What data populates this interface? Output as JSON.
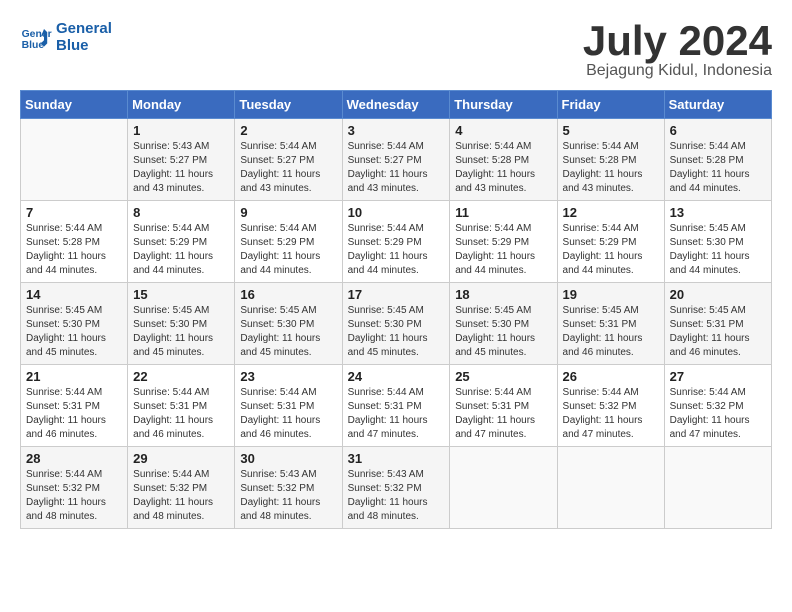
{
  "logo": {
    "line1": "General",
    "line2": "Blue"
  },
  "title": {
    "month": "July 2024",
    "location": "Bejagung Kidul, Indonesia"
  },
  "headers": [
    "Sunday",
    "Monday",
    "Tuesday",
    "Wednesday",
    "Thursday",
    "Friday",
    "Saturday"
  ],
  "weeks": [
    [
      {
        "day": "",
        "info": ""
      },
      {
        "day": "1",
        "info": "Sunrise: 5:43 AM\nSunset: 5:27 PM\nDaylight: 11 hours\nand 43 minutes."
      },
      {
        "day": "2",
        "info": "Sunrise: 5:44 AM\nSunset: 5:27 PM\nDaylight: 11 hours\nand 43 minutes."
      },
      {
        "day": "3",
        "info": "Sunrise: 5:44 AM\nSunset: 5:27 PM\nDaylight: 11 hours\nand 43 minutes."
      },
      {
        "day": "4",
        "info": "Sunrise: 5:44 AM\nSunset: 5:28 PM\nDaylight: 11 hours\nand 43 minutes."
      },
      {
        "day": "5",
        "info": "Sunrise: 5:44 AM\nSunset: 5:28 PM\nDaylight: 11 hours\nand 43 minutes."
      },
      {
        "day": "6",
        "info": "Sunrise: 5:44 AM\nSunset: 5:28 PM\nDaylight: 11 hours\nand 44 minutes."
      }
    ],
    [
      {
        "day": "7",
        "info": "Sunrise: 5:44 AM\nSunset: 5:28 PM\nDaylight: 11 hours\nand 44 minutes."
      },
      {
        "day": "8",
        "info": "Sunrise: 5:44 AM\nSunset: 5:29 PM\nDaylight: 11 hours\nand 44 minutes."
      },
      {
        "day": "9",
        "info": "Sunrise: 5:44 AM\nSunset: 5:29 PM\nDaylight: 11 hours\nand 44 minutes."
      },
      {
        "day": "10",
        "info": "Sunrise: 5:44 AM\nSunset: 5:29 PM\nDaylight: 11 hours\nand 44 minutes."
      },
      {
        "day": "11",
        "info": "Sunrise: 5:44 AM\nSunset: 5:29 PM\nDaylight: 11 hours\nand 44 minutes."
      },
      {
        "day": "12",
        "info": "Sunrise: 5:44 AM\nSunset: 5:29 PM\nDaylight: 11 hours\nand 44 minutes."
      },
      {
        "day": "13",
        "info": "Sunrise: 5:45 AM\nSunset: 5:30 PM\nDaylight: 11 hours\nand 44 minutes."
      }
    ],
    [
      {
        "day": "14",
        "info": "Sunrise: 5:45 AM\nSunset: 5:30 PM\nDaylight: 11 hours\nand 45 minutes."
      },
      {
        "day": "15",
        "info": "Sunrise: 5:45 AM\nSunset: 5:30 PM\nDaylight: 11 hours\nand 45 minutes."
      },
      {
        "day": "16",
        "info": "Sunrise: 5:45 AM\nSunset: 5:30 PM\nDaylight: 11 hours\nand 45 minutes."
      },
      {
        "day": "17",
        "info": "Sunrise: 5:45 AM\nSunset: 5:30 PM\nDaylight: 11 hours\nand 45 minutes."
      },
      {
        "day": "18",
        "info": "Sunrise: 5:45 AM\nSunset: 5:30 PM\nDaylight: 11 hours\nand 45 minutes."
      },
      {
        "day": "19",
        "info": "Sunrise: 5:45 AM\nSunset: 5:31 PM\nDaylight: 11 hours\nand 46 minutes."
      },
      {
        "day": "20",
        "info": "Sunrise: 5:45 AM\nSunset: 5:31 PM\nDaylight: 11 hours\nand 46 minutes."
      }
    ],
    [
      {
        "day": "21",
        "info": "Sunrise: 5:44 AM\nSunset: 5:31 PM\nDaylight: 11 hours\nand 46 minutes."
      },
      {
        "day": "22",
        "info": "Sunrise: 5:44 AM\nSunset: 5:31 PM\nDaylight: 11 hours\nand 46 minutes."
      },
      {
        "day": "23",
        "info": "Sunrise: 5:44 AM\nSunset: 5:31 PM\nDaylight: 11 hours\nand 46 minutes."
      },
      {
        "day": "24",
        "info": "Sunrise: 5:44 AM\nSunset: 5:31 PM\nDaylight: 11 hours\nand 47 minutes."
      },
      {
        "day": "25",
        "info": "Sunrise: 5:44 AM\nSunset: 5:31 PM\nDaylight: 11 hours\nand 47 minutes."
      },
      {
        "day": "26",
        "info": "Sunrise: 5:44 AM\nSunset: 5:32 PM\nDaylight: 11 hours\nand 47 minutes."
      },
      {
        "day": "27",
        "info": "Sunrise: 5:44 AM\nSunset: 5:32 PM\nDaylight: 11 hours\nand 47 minutes."
      }
    ],
    [
      {
        "day": "28",
        "info": "Sunrise: 5:44 AM\nSunset: 5:32 PM\nDaylight: 11 hours\nand 48 minutes."
      },
      {
        "day": "29",
        "info": "Sunrise: 5:44 AM\nSunset: 5:32 PM\nDaylight: 11 hours\nand 48 minutes."
      },
      {
        "day": "30",
        "info": "Sunrise: 5:43 AM\nSunset: 5:32 PM\nDaylight: 11 hours\nand 48 minutes."
      },
      {
        "day": "31",
        "info": "Sunrise: 5:43 AM\nSunset: 5:32 PM\nDaylight: 11 hours\nand 48 minutes."
      },
      {
        "day": "",
        "info": ""
      },
      {
        "day": "",
        "info": ""
      },
      {
        "day": "",
        "info": ""
      }
    ]
  ]
}
